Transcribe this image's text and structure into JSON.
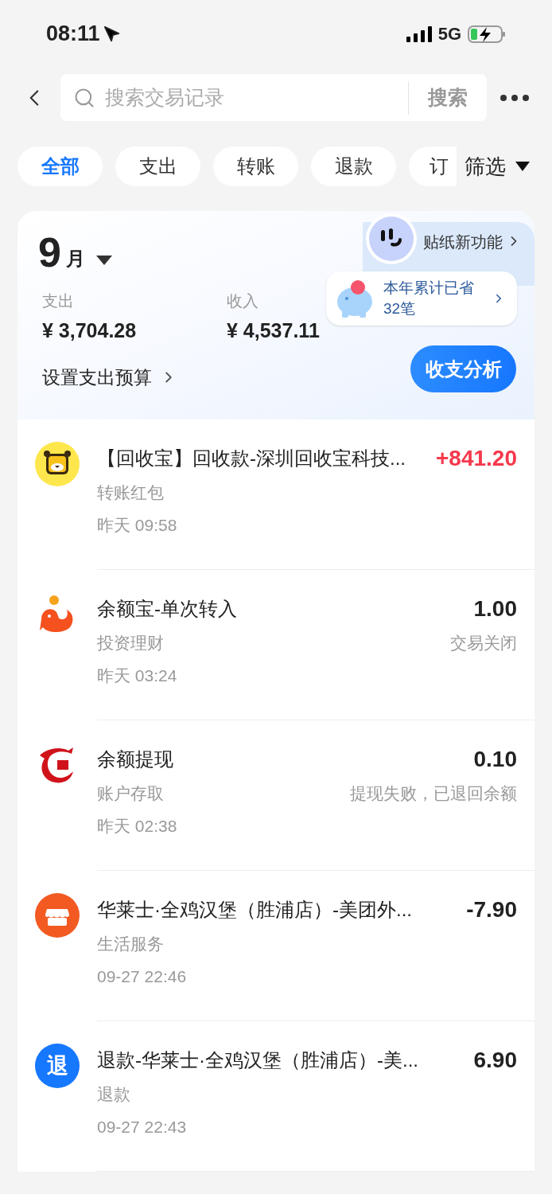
{
  "status_bar": {
    "time": "08:11",
    "network": "5G"
  },
  "search": {
    "placeholder": "搜索交易记录",
    "button": "搜索"
  },
  "filters": [
    {
      "label": "全部",
      "selected": true
    },
    {
      "label": "支出",
      "selected": false
    },
    {
      "label": "转账",
      "selected": false
    },
    {
      "label": "退款",
      "selected": false
    },
    {
      "label": "订",
      "selected": false
    }
  ],
  "filter_button": "筛选",
  "summary": {
    "month_number": "9",
    "month_unit": "月",
    "expense_label": "支出",
    "expense": "¥ 3,704.28",
    "income_label": "收入",
    "income": "¥ 4,537.11",
    "budget_link": "设置支出预算",
    "sticker_promo": "贴纸新功能",
    "savings_line1": "本年累计已省",
    "savings_line2": "32笔",
    "analysis_button": "收支分析"
  },
  "transactions": [
    {
      "kind": "tiger",
      "title": "【回收宝】回收款-深圳回收宝科技...",
      "amount": "+841.20",
      "income": true,
      "category": "转账红包",
      "time": "昨天 09:58"
    },
    {
      "kind": "fish",
      "title": "余额宝-单次转入",
      "amount": "1.00",
      "income": false,
      "category": "投资理财",
      "status": "交易关闭",
      "time": "昨天 03:24"
    },
    {
      "kind": "bank",
      "title": "余额提现",
      "amount": "0.10",
      "income": false,
      "category": "账户存取",
      "status": "提现失败，已退回余额",
      "time": "昨天 02:38"
    },
    {
      "kind": "shop",
      "title": "华莱士·全鸡汉堡（胜浦店）-美团外...",
      "amount": "-7.90",
      "income": false,
      "category": "生活服务",
      "time": "09-27 22:46"
    },
    {
      "kind": "refund",
      "icon_text": "退",
      "title": "退款-华莱士·全鸡汉堡（胜浦店）-美...",
      "amount": "6.90",
      "income": false,
      "category": "退款",
      "time": "09-27 22:43"
    }
  ]
}
